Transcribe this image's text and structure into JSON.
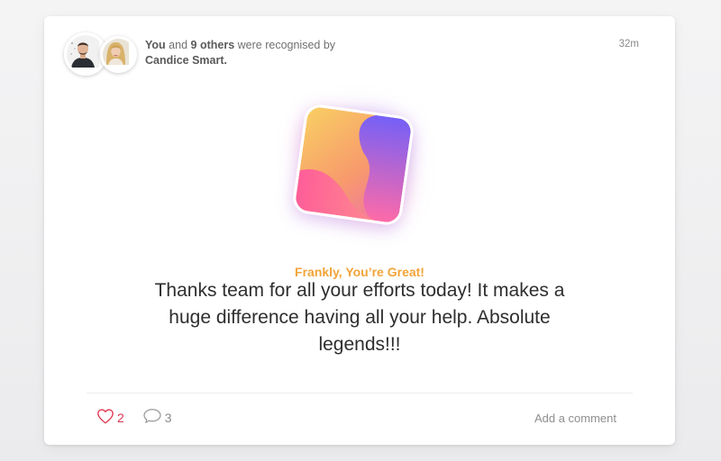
{
  "post": {
    "actor_you": "You",
    "conj": "and",
    "others": "9 others",
    "verb": "were recognised by",
    "recognizer": "Candice Smart.",
    "timestamp": "32m"
  },
  "award": {
    "title": "Frankly, You’re Great!",
    "message": "Thanks team for all your efforts today! It makes a huge difference having all your help. Absolute legends!!!",
    "badge_colors": [
      "#f7c15a",
      "#ff5c9e",
      "#6f5bff"
    ]
  },
  "footer": {
    "like_icon": "heart-outline-icon",
    "like_count": "2",
    "comment_icon": "speech-bubble-icon",
    "comment_count": "3",
    "add_comment_label": "Add a comment"
  },
  "colors": {
    "accent_orange": "#f2a43a",
    "like_red": "#e0344f",
    "text_dark": "#2e2e2e",
    "text_muted": "#8a8a8a"
  }
}
